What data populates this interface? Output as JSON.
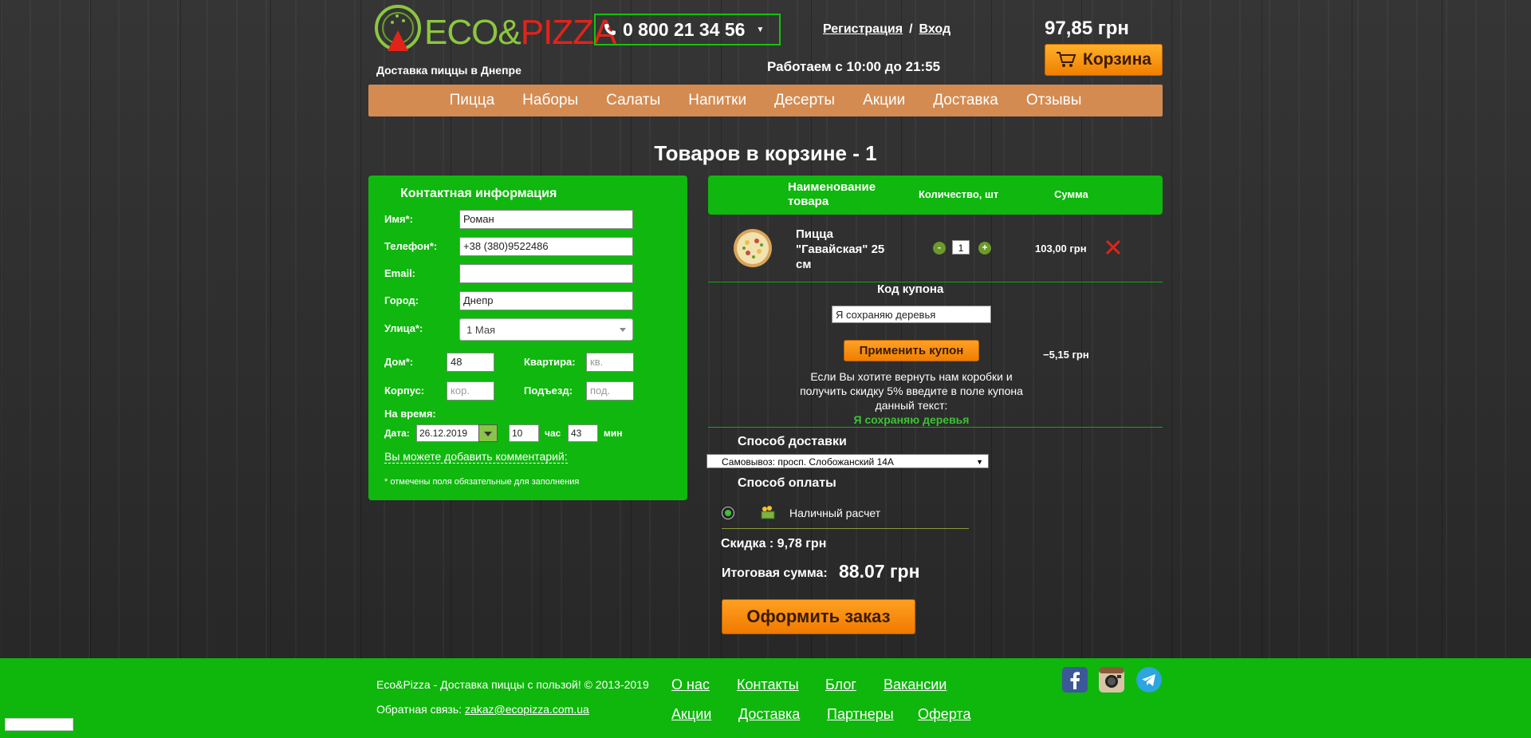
{
  "header": {
    "logo_eco": "ECO",
    "logo_amp": "&",
    "logo_pizza": "PIZZA",
    "tagline": "Доставка пиццы в Днепре",
    "phone": "0 800 21 34 56",
    "register": "Регистрация",
    "auth_sep": "/",
    "login": "Вход",
    "hours": "Работаем с 10:00 до 21:55",
    "cart_total": "97,85 грн",
    "cart_button": "Корзина"
  },
  "nav": [
    "Пицца",
    "Наборы",
    "Салаты",
    "Напитки",
    "Десерты",
    "Акции",
    "Доставка",
    "Отзывы"
  ],
  "page_title": "Товаров в корзине - 1",
  "contact": {
    "title": "Контактная информация",
    "name_label": "Имя*:",
    "name_value": "Роман",
    "phone_label": "Телефон*:",
    "phone_value": "+38 (380)9522486",
    "email_label": "Email:",
    "email_value": "",
    "city_label": "Город:",
    "city_value": "Днепр",
    "street_label": "Улица*:",
    "street_value": "1 Мая",
    "house_label": "Дом*:",
    "house_value": "48",
    "apt_label": "Квартира:",
    "apt_placeholder": "кв.",
    "building_label": "Корпус:",
    "building_placeholder": "кор.",
    "entrance_label": "Подъезд:",
    "entrance_placeholder": "под.",
    "time_label": "На время:",
    "date_label": "Дата:",
    "date_value": "26.12.2019",
    "hour_value": "10",
    "hour_unit": "час",
    "min_value": "43",
    "min_unit": "мин",
    "comment_link": "Вы можете добавить комментарий:",
    "required_note": "* отмечены поля обязательные для заполнения"
  },
  "cart": {
    "col_name": "Наименование товара",
    "col_qty": "Количество, шт",
    "col_sum": "Сумма",
    "items": [
      {
        "name": "Пицца \"Гавайская\" 25 см",
        "qty": "1",
        "sum": "103,00 грн",
        "minus": "-",
        "plus": "+"
      }
    ],
    "coupon_title": "Код купона",
    "coupon_value": "Я сохраняю деревья",
    "coupon_button": "Применить купон",
    "coupon_discount": "−5,15 грн",
    "coupon_hint": "Если Вы хотите вернуть нам коробки и получить скидку 5% введите в поле купона данный текст:",
    "coupon_hint_code": "Я сохраняю деревья",
    "delivery_title": "Способ доставки",
    "delivery_value": "Самовывоз: просп. Слобожанский 14А",
    "payment_title": "Способ оплаты",
    "payment_option": "Наличный расчет",
    "discount_text": "Скидка : 9,78 грн",
    "total_label": "Итоговая сумма:",
    "total_value": "88.07 грн",
    "order_button": "Оформить заказ"
  },
  "footer": {
    "copyright": "Eco&Pizza - Доставка пиццы с пользой! © 2013-2019",
    "feedback_label": "Обратная связь:",
    "feedback_email": "zakaz@ecopizza.com.ua",
    "links_row1": [
      "О нас",
      "Контакты",
      "Блог",
      "Вакансии"
    ],
    "links_row2": [
      "Акции",
      "Доставка",
      "Партнеры",
      "Оферта"
    ]
  },
  "colors": {
    "green": "#10b70e",
    "orange": "#f07f00",
    "nav": "#d38b52",
    "delete_red": "#e2231a"
  },
  "icons": [
    "phone-icon",
    "cart-icon",
    "pizza-image",
    "delete-icon",
    "cash-icon",
    "facebook-icon",
    "instagram-icon",
    "telegram-icon"
  ]
}
